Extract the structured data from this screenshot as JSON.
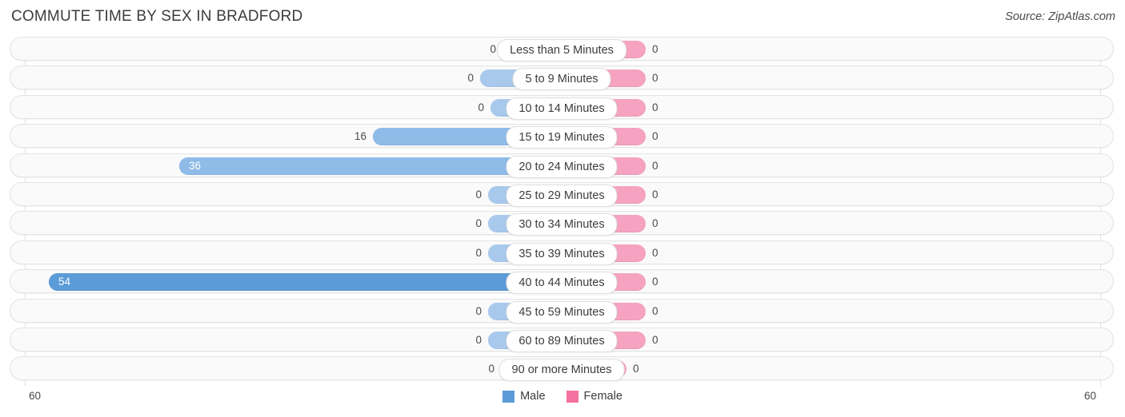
{
  "header": {
    "title": "COMMUTE TIME BY SEX IN BRADFORD",
    "source": "Source: ZipAtlas.com"
  },
  "axis": {
    "left_label": "60",
    "right_label": "60"
  },
  "legend": {
    "items": [
      {
        "label": "Male",
        "color": "#5b9bd8"
      },
      {
        "label": "Female",
        "color": "#f4729f"
      }
    ]
  },
  "colors": {
    "male_bar": "#a9c9ec",
    "male_bar_mid": "#8fbbe8",
    "male_bar_high": "#5b9bd8",
    "female_bar": "#f5a3c0",
    "track": "#fafafa",
    "gridline": "#e2e2e2"
  },
  "chart_data": {
    "type": "bar",
    "title": "COMMUTE TIME BY SEX IN BRADFORD",
    "subtitle": "",
    "xlabel": "",
    "ylabel": "",
    "orientation": "horizontal-diverging",
    "xlim": [
      60,
      60
    ],
    "grid": true,
    "legend_position": "bottom-center",
    "categories": [
      "Less than 5 Minutes",
      "5 to 9 Minutes",
      "10 to 14 Minutes",
      "15 to 19 Minutes",
      "20 to 24 Minutes",
      "25 to 29 Minutes",
      "30 to 34 Minutes",
      "35 to 39 Minutes",
      "40 to 44 Minutes",
      "45 to 59 Minutes",
      "60 to 89 Minutes",
      "90 or more Minutes"
    ],
    "series": [
      {
        "name": "Male",
        "values": [
          0,
          0,
          0,
          16,
          36,
          0,
          0,
          0,
          54,
          0,
          0,
          0
        ]
      },
      {
        "name": "Female",
        "values": [
          0,
          0,
          0,
          0,
          0,
          0,
          0,
          0,
          0,
          0,
          0,
          0
        ]
      }
    ]
  },
  "rows": [
    {
      "label": "Less than 5 Minutes",
      "male": "0",
      "female": "0",
      "male_w": 60,
      "female_w": 91,
      "male_inside": false
    },
    {
      "label": "5 to 9 Minutes",
      "male": "0",
      "female": "0",
      "male_w": 88,
      "female_w": 91,
      "male_inside": false
    },
    {
      "label": "10 to 14 Minutes",
      "male": "0",
      "female": "0",
      "male_w": 75,
      "female_w": 91,
      "male_inside": false
    },
    {
      "label": "15 to 19 Minutes",
      "male": "16",
      "female": "0",
      "male_w": 222,
      "female_w": 91,
      "male_inside": false
    },
    {
      "label": "20 to 24 Minutes",
      "male": "36",
      "female": "0",
      "male_w": 464,
      "female_w": 91,
      "male_inside": true
    },
    {
      "label": "25 to 29 Minutes",
      "male": "0",
      "female": "0",
      "male_w": 78,
      "female_w": 91,
      "male_inside": false
    },
    {
      "label": "30 to 34 Minutes",
      "male": "0",
      "female": "0",
      "male_w": 78,
      "female_w": 91,
      "male_inside": false
    },
    {
      "label": "35 to 39 Minutes",
      "male": "0",
      "female": "0",
      "male_w": 78,
      "female_w": 91,
      "male_inside": false
    },
    {
      "label": "40 to 44 Minutes",
      "male": "54",
      "female": "0",
      "male_w": 627,
      "female_w": 91,
      "male_inside": true
    },
    {
      "label": "45 to 59 Minutes",
      "male": "0",
      "female": "0",
      "male_w": 78,
      "female_w": 91,
      "male_inside": false
    },
    {
      "label": "60 to 89 Minutes",
      "male": "0",
      "female": "0",
      "male_w": 78,
      "female_w": 91,
      "male_inside": false
    },
    {
      "label": "90 or more Minutes",
      "male": "0",
      "female": "0",
      "male_w": 62,
      "female_w": 67,
      "male_inside": false
    }
  ]
}
